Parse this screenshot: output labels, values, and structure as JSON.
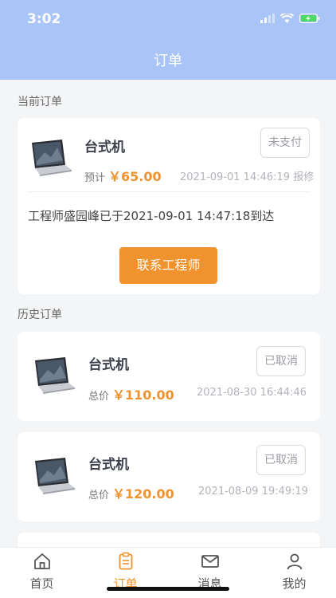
{
  "status_bar": {
    "time": "3:02"
  },
  "nav": {
    "title": "订单"
  },
  "current": {
    "section_label": "当前订单",
    "product": "台式机",
    "price_label": "预计",
    "price": "￥65.00",
    "date": "2021-09-01 14:46:19",
    "type": "报修",
    "status": "未支付",
    "arrival_text": "工程师盛园峰已于2021-09-01 14:47:18到达",
    "contact_button": "联系工程师"
  },
  "history": {
    "section_label": "历史订单",
    "items": [
      {
        "product": "台式机",
        "price_label": "总价",
        "price": "￥110.00",
        "date": "2021-08-30 16:44:46",
        "status": "已取消"
      },
      {
        "product": "台式机",
        "price_label": "总价",
        "price": "￥120.00",
        "date": "2021-08-09 19:49:19",
        "status": "已取消"
      }
    ]
  },
  "tabbar": {
    "tabs": [
      {
        "label": "首页",
        "icon": "home-icon"
      },
      {
        "label": "订单",
        "icon": "orders-icon"
      },
      {
        "label": "消息",
        "icon": "mail-icon"
      },
      {
        "label": "我的",
        "icon": "profile-icon"
      }
    ],
    "active": "订单"
  },
  "colors": {
    "header": "#a9c4f7",
    "accent": "#f0922e",
    "background": "#f4f5f7"
  }
}
